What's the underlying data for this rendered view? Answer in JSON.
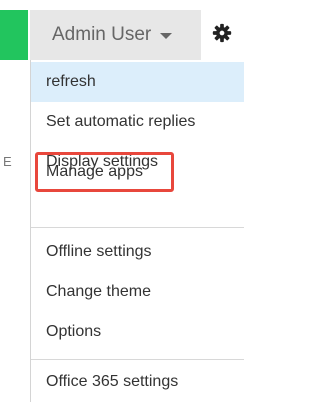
{
  "header": {
    "user_name": "Admin User",
    "accent_color": "#22c55e",
    "settings_icon": "gear-icon"
  },
  "left_edge_text": "E",
  "menu": {
    "items": [
      {
        "label": "refresh",
        "highlighted": true
      },
      {
        "label": "Set automatic replies"
      },
      {
        "label": "Display settings"
      },
      {
        "label": "Manage apps",
        "outlined": true,
        "outline_color": "#e8473c"
      },
      {
        "label": "Offline settings"
      },
      {
        "label": "Change theme"
      },
      {
        "label": "Options"
      },
      {
        "label": "Office 365 settings"
      }
    ]
  }
}
